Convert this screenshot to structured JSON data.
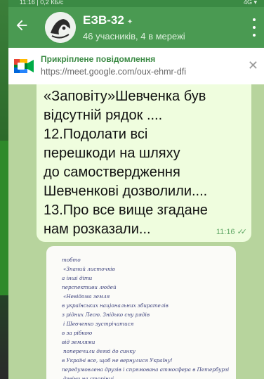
{
  "statusbar": {
    "left": "11:16 | 0,2 КБ/с",
    "right": "4G ▾"
  },
  "header": {
    "title": "ЕЗВ-32",
    "mute_icon": "muted-icon",
    "subtitle": "46 учасників, 4 в мережі"
  },
  "pinned": {
    "title": "Прикріплене повідомлення",
    "text": "https://meet.google.com/oux-ehmr-dfi",
    "icon": "google-meet-icon"
  },
  "message": {
    "lines": [
      "«Заповіту»Шевченка  був",
      "відсутній рядок ....",
      "12.Подолати всі",
      "перешкоди на шляху",
      "до самоствердження",
      "Шевченкові дозволили....",
      "13.Про все вище згадане",
      "нам розказали..."
    ],
    "time": "11:16",
    "status_icon": "double-check-icon"
  },
  "photo": {
    "description_icon": "handwritten-page-photo",
    "handwriting_lines": [
      "тобто",
      "«Знаний листочків",
      "а інші діти",
      "перспективи людей",
      "«Невідома земля",
      "в українських національних збирателів",
      "з рідних Лесю. Знідько сну рядів",
      "і Шевченко зустрічатися",
      "в за рібкою",
      "від землями",
      "поперечили деякі до синку",
      "в Україні все, щоб не вернулися Україну!",
      "передумовлена друзів і спрямована атмосфера в Петербурзі",
      "дзвіни на сторінці"
    ]
  },
  "colors": {
    "header": "#4a9a52",
    "chat_bg": "#b7d49d",
    "bubble_out": "#effdde",
    "accent": "#3b8a44"
  }
}
